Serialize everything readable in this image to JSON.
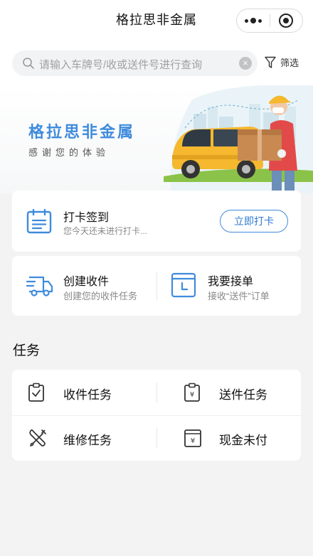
{
  "header": {
    "title": "格拉思非金属"
  },
  "search": {
    "placeholder": "请输入车牌号/收或送件号进行查询",
    "filter_label": "筛选"
  },
  "banner": {
    "brand": "格拉思非金属",
    "slogan": "感谢您的体验"
  },
  "checkin": {
    "title": "打卡签到",
    "subtitle": "您今天还未进行打卡...",
    "button_label": "立即打卡"
  },
  "actions": [
    {
      "title": "创建收件",
      "subtitle": "创建您的收件任务",
      "icon": "delivery-truck-icon"
    },
    {
      "title": "我要接单",
      "subtitle": "接收“送件”订单",
      "icon": "calendar-clock-icon"
    }
  ],
  "tasks": {
    "section_title": "任务",
    "items": [
      {
        "label": "收件任务",
        "icon": "clipboard-check-icon"
      },
      {
        "label": "送件任务",
        "icon": "clipboard-yen-icon"
      },
      {
        "label": "维修任务",
        "icon": "wrench-screwdriver-icon"
      },
      {
        "label": "现金未付",
        "icon": "cash-drawer-icon"
      }
    ]
  },
  "colors": {
    "accent": "#3f8bdc",
    "background": "#f3f3f3",
    "card": "#ffffff"
  }
}
